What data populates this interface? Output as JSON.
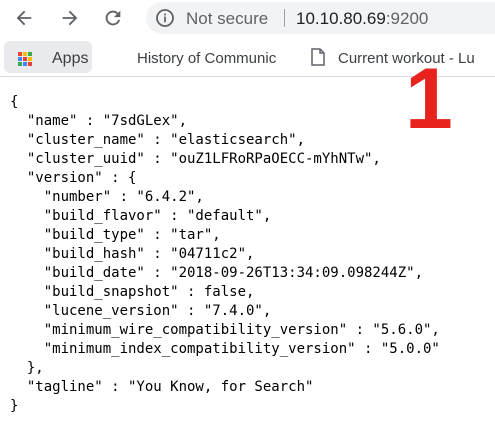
{
  "browser": {
    "security_label": "Not secure",
    "url_host": "10.10.80.69",
    "url_port": ":9200",
    "icons": {
      "back": "arrow-left-icon",
      "forward": "arrow-right-icon",
      "reload": "reload-icon",
      "info": "info-icon"
    }
  },
  "bookmarks": {
    "apps_label": "Apps",
    "apps_colors": [
      "#ea4335",
      "#fbbc05",
      "#34a853",
      "#4285f4",
      "#ea4335",
      "#fbbc05",
      "#34a853",
      "#4285f4",
      "#ea4335"
    ],
    "items": [
      {
        "label": "History of Communic"
      },
      {
        "label": "Current workout - Lu"
      }
    ]
  },
  "document": {
    "lines": [
      "{",
      "  \"name\" : \"7sdGLex\",",
      "  \"cluster_name\" : \"elasticsearch\",",
      "  \"cluster_uuid\" : \"ouZ1LFRoRPaOECC-mYhNTw\",",
      "  \"version\" : {",
      "    \"number\" : \"6.4.2\",",
      "    \"build_flavor\" : \"default\",",
      "    \"build_type\" : \"tar\",",
      "    \"build_hash\" : \"04711c2\",",
      "    \"build_date\" : \"2018-09-26T13:34:09.098244Z\",",
      "    \"build_snapshot\" : false,",
      "    \"lucene_version\" : \"7.4.0\",",
      "    \"minimum_wire_compatibility_version\" : \"5.6.0\",",
      "    \"minimum_index_compatibility_version\" : \"5.0.0\"",
      "  },",
      "  \"tagline\" : \"You Know, for Search\"",
      "}"
    ]
  },
  "annotation": {
    "label": "1",
    "color": "#e8221c"
  }
}
